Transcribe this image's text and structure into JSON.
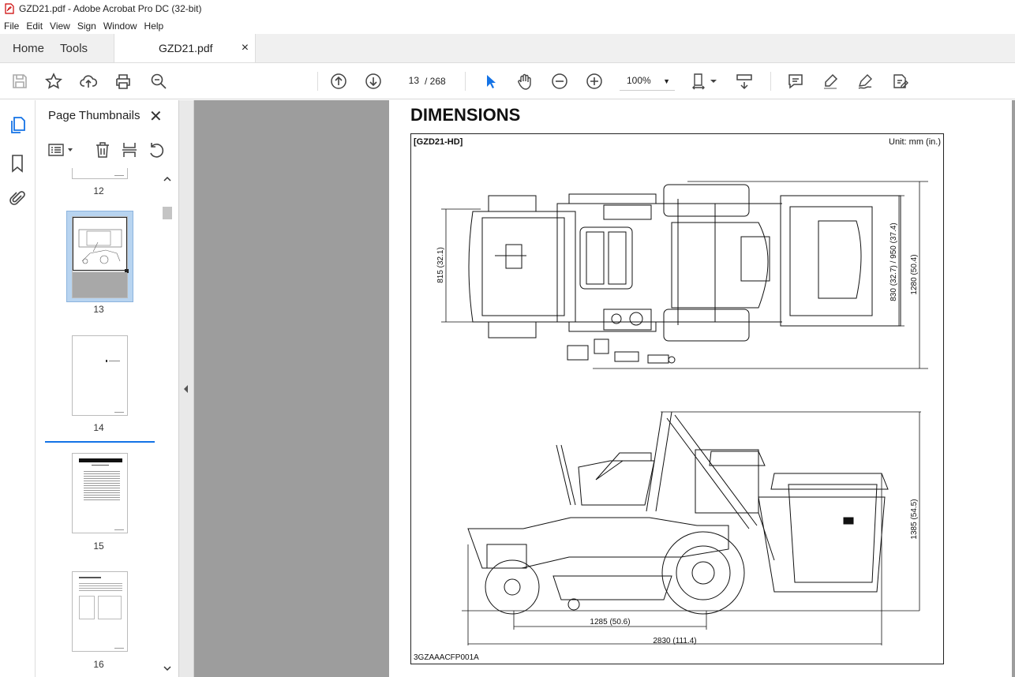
{
  "window": {
    "title": "GZD21.pdf - Adobe Acrobat Pro DC (32-bit)"
  },
  "menu": [
    "File",
    "Edit",
    "View",
    "Sign",
    "Window",
    "Help"
  ],
  "tabs": {
    "home": "Home",
    "tools": "Tools",
    "doc": "GZD21.pdf",
    "close": "×"
  },
  "toolbar": {
    "page_current": "13",
    "page_total": "/ 268",
    "zoom": "100%"
  },
  "panel": {
    "title": "Page Thumbnails",
    "thumbnails": [
      {
        "label": "12"
      },
      {
        "label": "13"
      },
      {
        "label": "14"
      },
      {
        "label": "15"
      },
      {
        "label": "16"
      }
    ]
  },
  "document": {
    "heading": "DIMENSIONS",
    "model": "[GZD21-HD]",
    "unit": "Unit: mm (in.)",
    "figure_code": "3GZAAACFP001A",
    "dims": {
      "top_width": "815 (32.1)",
      "top_mid": "830 (32.7) / 950 (37.4)",
      "top_total": "1280 (50.4)",
      "side_height": "1385 (54.5)",
      "wheelbase": "1285 (50.6)",
      "length": "2830 (111.4)"
    }
  },
  "colors": {
    "accent": "#1473e6",
    "selected": "#b8d4f0"
  }
}
